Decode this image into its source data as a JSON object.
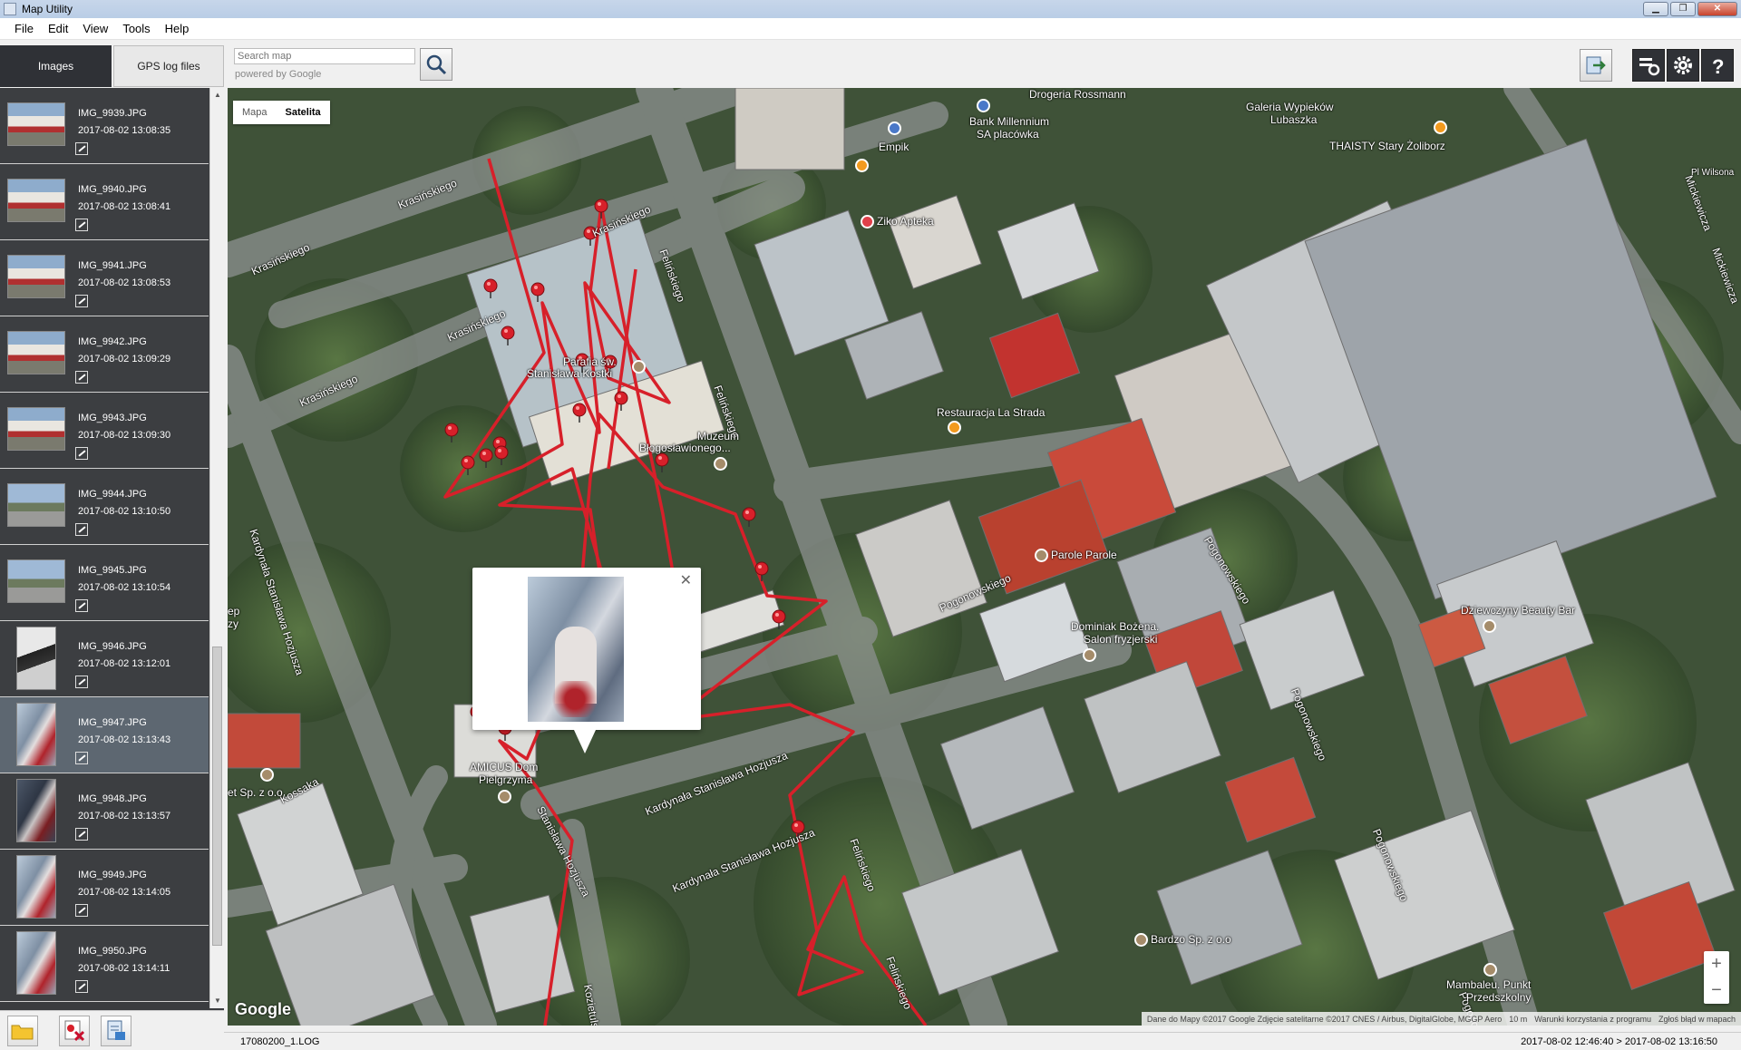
{
  "window": {
    "title": "Map Utility"
  },
  "menu": {
    "file": "File",
    "edit": "Edit",
    "view": "View",
    "tools": "Tools",
    "help": "Help"
  },
  "tabs": {
    "images": "Images",
    "gps": "GPS log files"
  },
  "search": {
    "placeholder": "Search map",
    "powered_by": "powered by Google"
  },
  "images": [
    {
      "name": "IMG_9939.JPG",
      "date": "2017-08-02 13:08:35",
      "thumb": "building-red"
    },
    {
      "name": "IMG_9940.JPG",
      "date": "2017-08-02 13:08:41",
      "thumb": "building-red"
    },
    {
      "name": "IMG_9941.JPG",
      "date": "2017-08-02 13:08:53",
      "thumb": "building-red"
    },
    {
      "name": "IMG_9942.JPG",
      "date": "2017-08-02 13:09:29",
      "thumb": "building-red"
    },
    {
      "name": "IMG_9943.JPG",
      "date": "2017-08-02 13:09:30",
      "thumb": "building-red"
    },
    {
      "name": "IMG_9944.JPG",
      "date": "2017-08-02 13:10:50",
      "thumb": "street"
    },
    {
      "name": "IMG_9945.JPG",
      "date": "2017-08-02 13:10:54",
      "thumb": "street"
    },
    {
      "name": "IMG_9946.JPG",
      "date": "2017-08-02 13:12:01",
      "thumb": "tower"
    },
    {
      "name": "IMG_9947.JPG",
      "date": "2017-08-02 13:13:43",
      "thumb": "mosaic"
    },
    {
      "name": "IMG_9948.JPG",
      "date": "2017-08-02 13:13:57",
      "thumb": "mosaic-dark"
    },
    {
      "name": "IMG_9949.JPG",
      "date": "2017-08-02 13:14:05",
      "thumb": "mosaic"
    },
    {
      "name": "IMG_9950.JPG",
      "date": "2017-08-02 13:14:11",
      "thumb": "mosaic"
    }
  ],
  "selected_image": "IMG_9947.JPG",
  "map": {
    "type_map": "Mapa",
    "type_satellite": "Satelita",
    "google": "Google",
    "zoom_in": "+",
    "zoom_out": "−",
    "attribution": "Dane do Mapy ©2017 Google Zdjęcie satelitarne ©2017 CNES / Airbus, DigitalGlobe, MGGP Aero",
    "scale": "10 m",
    "terms": "Warunki korzystania z programu",
    "report": "Zgłoś błąd w mapach",
    "streets": {
      "krasinskiego": "Krasińskiego",
      "felinskiego": "Felińskiego",
      "pogonowskiego": "Pogonowskiego",
      "hozjusza_full": "Kardynała Stanisława Hozjusza",
      "hozjusza_short": "Stanisława Hozjusza",
      "kossaka": "Kossaka",
      "kozietulskiego": "Kozietulskiego",
      "mickiewicza": "Mickiewicza",
      "wilsona": "Pl Wilsona"
    },
    "pois": {
      "rossmann": "Drogeria Rossmann",
      "galeria_1": "Galeria Wypieków",
      "galeria_2": "Lubaszka",
      "thaisty": "THAISTY Stary Żoliborz",
      "bank_1": "Bank Millennium",
      "bank_2": "SA placówka",
      "empik": "Empik",
      "ziko": "Ziko Apteka",
      "parafia_1": "Parafia św.",
      "parafia_2": "Stanisława Kostki",
      "muzeum_1": "Muzeum",
      "muzeum_2": "Błogosławionego...",
      "lastrada": "Restauracja La Strada",
      "parole": "Parole Parole",
      "dominiak_1": "Dominiak Bożena.",
      "dominiak_2": "Salon fryzjerski",
      "dziewczyny": "Dziewczyny Beauty Bar",
      "amicus_1": "AMICUS Dom",
      "amicus_2": "Pielgrzyma",
      "bardzo": "Bardzo Sp. z o.o",
      "mambaleu_1": "Mambaleu. Punkt",
      "mambaleu_2": "Przedszkolny",
      "spzoo": "et Sp. z o.o",
      "ep": "ep",
      "zy": "zy"
    }
  },
  "status": {
    "file": "17080200_1.LOG",
    "range": "2017-08-02 12:46:40 > 2017-08-02 13:16:50"
  },
  "colors": {
    "track": "#d7202a",
    "sidebar": "#3c3e41",
    "selected": "#5d6771"
  }
}
